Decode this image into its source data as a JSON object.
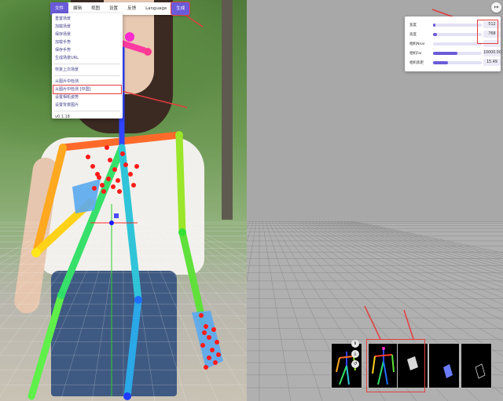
{
  "menu": {
    "items": [
      {
        "label": "文件",
        "state": "file"
      },
      {
        "label": "编辑",
        "state": ""
      },
      {
        "label": "视图",
        "state": ""
      },
      {
        "label": "设置",
        "state": ""
      },
      {
        "label": "反馈",
        "state": ""
      },
      {
        "label": "Language",
        "state": ""
      },
      {
        "label": "生成",
        "state": "active"
      }
    ]
  },
  "dropdown": {
    "items": [
      "重置场景",
      "加载场景",
      "保存场景",
      "加载手势",
      "保存手势",
      "生成场景URL"
    ],
    "items2": [
      "恢复上次场景"
    ],
    "items3": [
      "从图片中检测",
      "从图片中检测 [中国]",
      "设置相机姿势",
      "设置背景图片"
    ],
    "version": "v0.1.18"
  },
  "panel": {
    "rows": [
      {
        "label": "宽度",
        "value": "512",
        "fill": 0.05
      },
      {
        "label": "高度",
        "value": "768",
        "fill": 0.08
      },
      {
        "label": "相机Near",
        "value": "",
        "fill": 0.0
      },
      {
        "label": "相机Far",
        "value": "10000.00",
        "fill": 0.5
      },
      {
        "label": "相机焦距",
        "value": "15.49",
        "fill": 0.3
      }
    ]
  },
  "corner": {
    "icon": "↦"
  },
  "tools": [
    "ℹ",
    "⤓",
    "↺"
  ],
  "colors": {
    "accent": "#6a5bd8",
    "highlight": "#e43d3d"
  }
}
